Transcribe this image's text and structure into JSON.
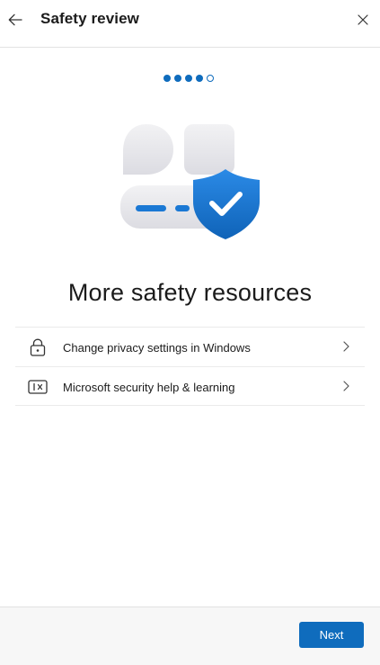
{
  "header": {
    "title": "Safety review"
  },
  "icons": {
    "back": "arrow-left-icon",
    "close": "close-icon",
    "lock": "lock-icon",
    "security": "security-card-icon",
    "chevron": "chevron-right-icon"
  },
  "progress": {
    "total_steps": 5,
    "completed_steps": 4
  },
  "main": {
    "heading": "More safety resources",
    "items": [
      {
        "label": "Change privacy settings in Windows",
        "icon": "lock-icon"
      },
      {
        "label": "Microsoft security help & learning",
        "icon": "security-card-icon"
      }
    ]
  },
  "footer": {
    "next_label": "Next"
  },
  "colors": {
    "accent": "#0f6cbd",
    "shield": "#1a78d4",
    "divider": "#ebebeb"
  }
}
